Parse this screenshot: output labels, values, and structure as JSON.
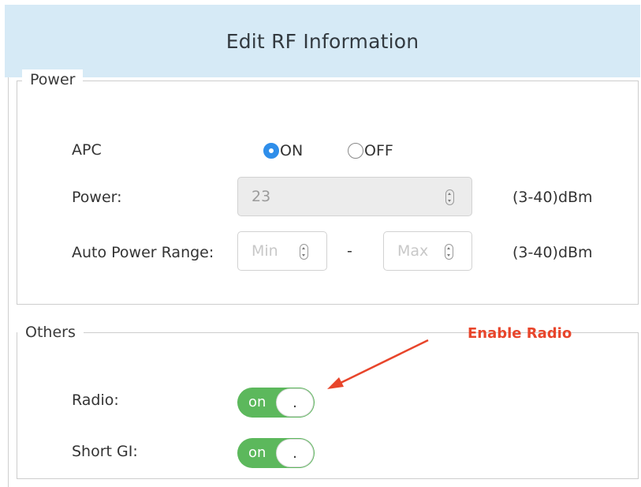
{
  "dialog": {
    "title": "Edit RF Information"
  },
  "power_section": {
    "legend": "Power",
    "apc": {
      "label": "APC",
      "options": [
        {
          "label": "ON",
          "checked": true
        },
        {
          "label": "OFF",
          "checked": false
        }
      ]
    },
    "power": {
      "label": "Power:",
      "value": "23",
      "disabled": true,
      "unit": "(3-40)dBm"
    },
    "auto_power_range": {
      "label": "Auto Power Range:",
      "min_placeholder": "Min",
      "separator": "-",
      "max_placeholder": "Max",
      "unit": "(3-40)dBm"
    }
  },
  "others_section": {
    "legend": "Others",
    "radio": {
      "label": "Radio:",
      "state": "on",
      "knob": "."
    },
    "short_gi": {
      "label": "Short GI:",
      "state": "on",
      "knob": "."
    }
  },
  "annotation": {
    "text": "Enable Radio",
    "color": "#e8452b"
  },
  "colors": {
    "header_bg": "#d6eaf6",
    "toggle_on": "#5cb85c",
    "radio_checked": "#2f8eea"
  }
}
